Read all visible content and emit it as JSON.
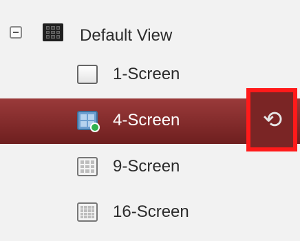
{
  "tree": {
    "root": {
      "label": "Default View",
      "icon": "view-grid-icon",
      "expanded": true
    },
    "children": [
      {
        "label": "1-Screen",
        "icon": "single-screen-icon",
        "selected": false
      },
      {
        "label": "4-Screen",
        "icon": "four-screen-icon",
        "selected": true
      },
      {
        "label": "9-Screen",
        "icon": "nine-screen-icon",
        "selected": false
      },
      {
        "label": "16-Screen",
        "icon": "sixteen-screen-icon",
        "selected": false
      }
    ],
    "restore_icon": "restore-icon",
    "colors": {
      "selected_row": "#8a2d2d",
      "highlight_frame": "#ff1a1a",
      "background": "#f2f2f2"
    }
  }
}
